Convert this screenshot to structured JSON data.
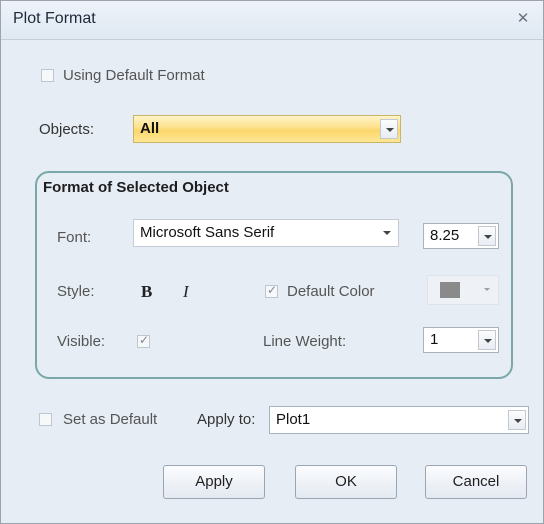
{
  "window": {
    "title": "Plot Format"
  },
  "using_default_format": {
    "label": "Using Default Format",
    "checked": false
  },
  "objects": {
    "label": "Objects:",
    "value": "All"
  },
  "group": {
    "title": "Format of Selected Object",
    "font_label": "Font:",
    "font_value": "Microsoft Sans Serif",
    "font_size": "8.25",
    "style_label": "Style:",
    "bold_glyph": "B",
    "italic_glyph": "I",
    "default_color_label": "Default Color",
    "default_color_checked": true,
    "visible_label": "Visible:",
    "visible_checked": true,
    "line_weight_label": "Line Weight:",
    "line_weight_value": "1",
    "color_swatch": "#8a8a8a"
  },
  "set_as_default": {
    "label": "Set as Default",
    "checked": false
  },
  "apply_to": {
    "label": "Apply to:",
    "value": "Plot1"
  },
  "buttons": {
    "apply": "Apply",
    "ok": "OK",
    "cancel": "Cancel"
  },
  "icons": {
    "close": "close-icon",
    "dropdown": "chevron-down-icon"
  }
}
